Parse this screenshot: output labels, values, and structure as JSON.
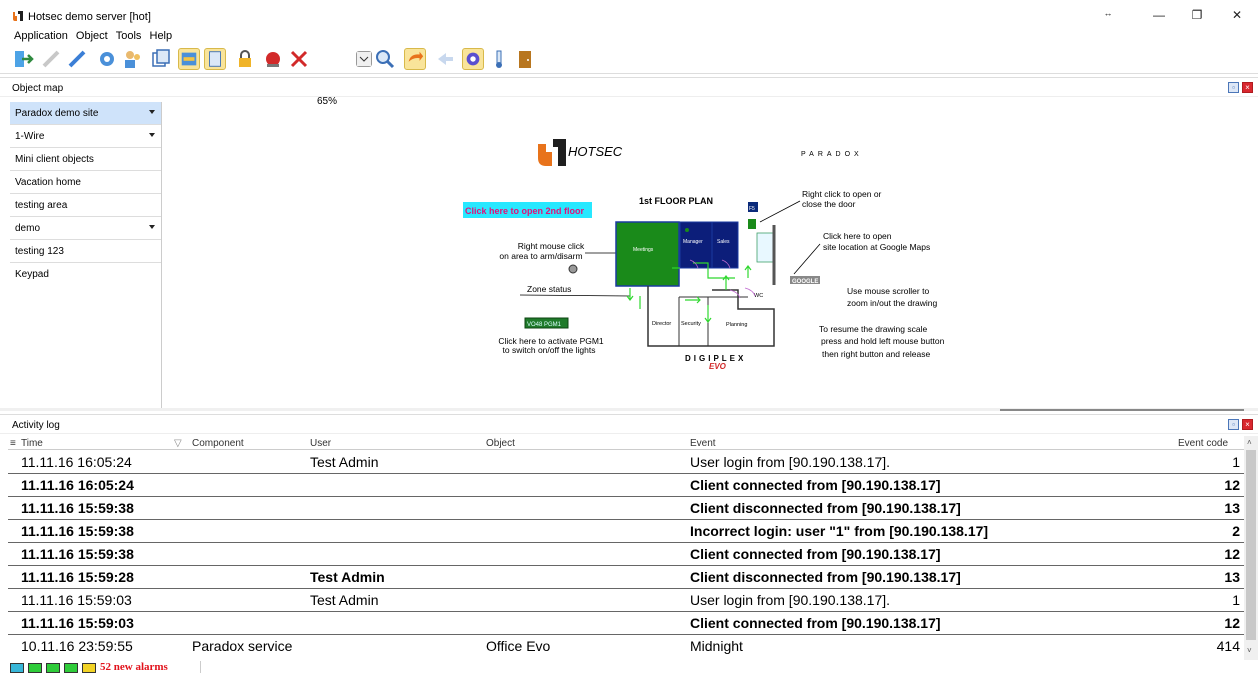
{
  "window": {
    "title": "Hotsec demo server [hot]"
  },
  "menu": [
    "Application",
    "Object",
    "Tools",
    "Help"
  ],
  "toolbar": {
    "zoom": "65%"
  },
  "object_map": {
    "header": "Object map",
    "sites": [
      {
        "label": "Paradox demo site",
        "has_dropdown": true,
        "active": true
      },
      {
        "label": "1-Wire",
        "has_dropdown": true
      },
      {
        "label": "Mini client objects"
      },
      {
        "label": "Vacation home"
      },
      {
        "label": "testing area"
      },
      {
        "label": "demo",
        "has_dropdown": true
      },
      {
        "label": "testing 123"
      },
      {
        "label": "Keypad"
      }
    ],
    "drawing": {
      "logo": "HOTSEC",
      "paradox": "PARADOX",
      "plan_title": "1st FLOOR PLAN",
      "open_2nd_floor": "Click here to open 2nd floor",
      "door_hint": "Right click to open or\nclose the door",
      "maps_hint": "Click here to open\nsite location at Google Maps",
      "google": "GOOGLE",
      "arm_hint": "Right mouse click\non area to arm/disarm",
      "zone_status": "Zone status",
      "scroll_hint": "Use mouse scroller to\nzoom in/out the drawing",
      "scale_hint": "To resume the drawing scale\npress and hold left mouse button\nthen right button and release",
      "pgm_button": "VO48 PGM1",
      "pgm_hint": "Click here to activate PGM1\nto switch on/off the lights",
      "digiplex": "DIGIPLEX",
      "evo": "EVO",
      "rooms": [
        "Meetings",
        "Manager",
        "Sales",
        "Director",
        "Security",
        "Planning",
        "WC"
      ]
    }
  },
  "activity_log": {
    "header": "Activity log",
    "columns": [
      "Time",
      "Component",
      "User",
      "Object",
      "Event",
      "Event code"
    ],
    "rows": [
      {
        "time": "11.11.16 16:05:24",
        "component": "",
        "user": "Test Admin",
        "object": "",
        "event": "User login from [90.190.138.17].",
        "code": "1",
        "bold": false
      },
      {
        "time": "11.11.16 16:05:24",
        "component": "",
        "user": "",
        "object": "",
        "event": "Client connected from [90.190.138.17]",
        "code": "12",
        "bold": true
      },
      {
        "time": "11.11.16 15:59:38",
        "component": "",
        "user": "",
        "object": "",
        "event": "Client disconnected from [90.190.138.17]",
        "code": "13",
        "bold": true
      },
      {
        "time": "11.11.16 15:59:38",
        "component": "",
        "user": "",
        "object": "",
        "event": "Incorrect login: user \"1\" from [90.190.138.17]",
        "code": "2",
        "bold": true
      },
      {
        "time": "11.11.16 15:59:38",
        "component": "",
        "user": "",
        "object": "",
        "event": "Client connected from [90.190.138.17]",
        "code": "12",
        "bold": true
      },
      {
        "time": "11.11.16 15:59:28",
        "component": "",
        "user": "Test Admin",
        "object": "",
        "event": "Client disconnected from [90.190.138.17]",
        "code": "13",
        "bold": true
      },
      {
        "time": "11.11.16 15:59:03",
        "component": "",
        "user": "Test Admin",
        "object": "",
        "event": "User login from [90.190.138.17].",
        "code": "1",
        "bold": false
      },
      {
        "time": "11.11.16 15:59:03",
        "component": "",
        "user": "",
        "object": "",
        "event": "Client connected from [90.190.138.17]",
        "code": "12",
        "bold": true
      },
      {
        "time": "10.11.16 23:59:55",
        "component": "Paradox service",
        "user": "",
        "object": "Office Evo",
        "event": "Midnight",
        "code": "414",
        "bold": false
      }
    ]
  },
  "status": {
    "alarms": "52 new alarms"
  }
}
